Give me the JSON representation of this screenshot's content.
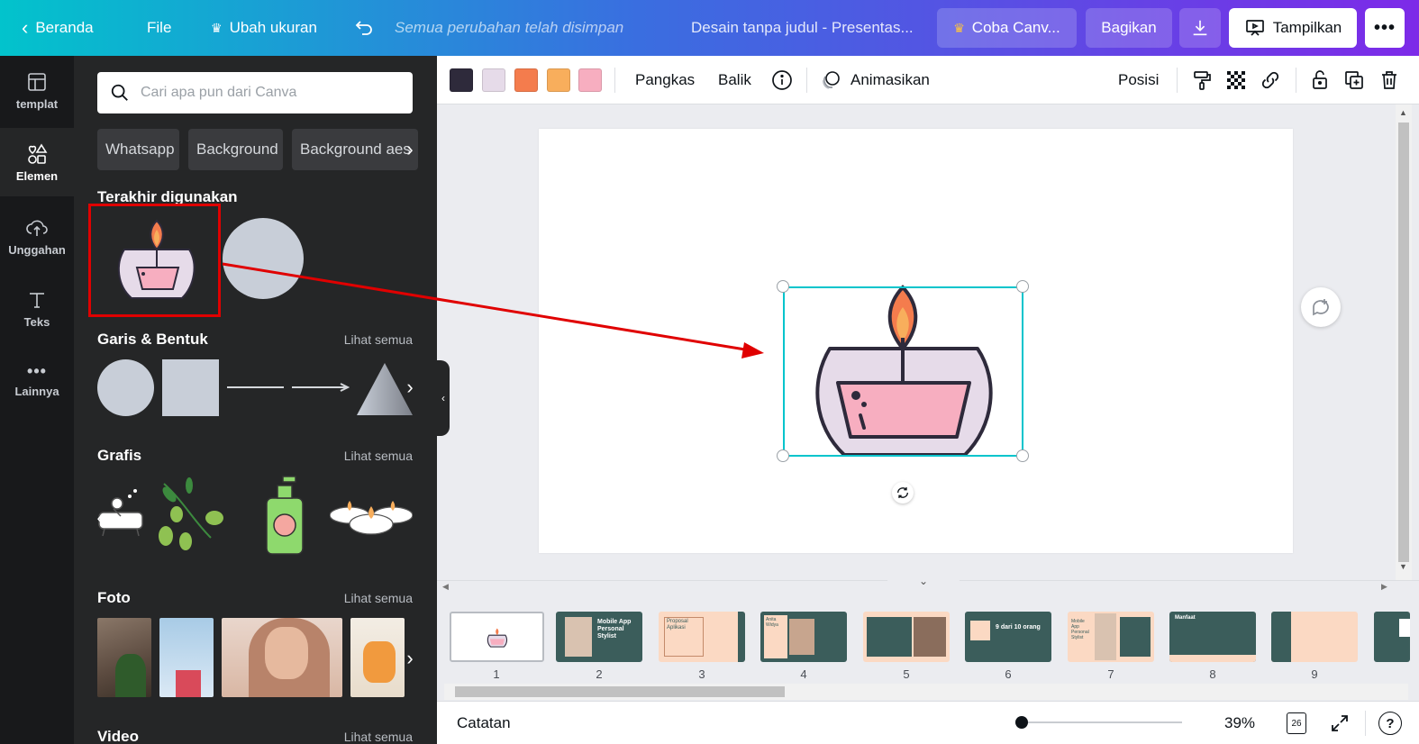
{
  "topbar": {
    "home": "Beranda",
    "file": "File",
    "resize": "Ubah ukuran",
    "saved_status": "Semua perubahan telah disimpan",
    "doc_title": "Desain tanpa judul - Presentas...",
    "try_pro": "Coba Canv...",
    "share": "Bagikan",
    "present": "Tampilkan"
  },
  "rail": [
    {
      "label": "templat",
      "icon": "template-icon"
    },
    {
      "label": "Elemen",
      "icon": "elements-icon"
    },
    {
      "label": "Unggahan",
      "icon": "upload-icon"
    },
    {
      "label": "Teks",
      "icon": "text-icon"
    },
    {
      "label": "Lainnya",
      "icon": "more-icon"
    }
  ],
  "panel": {
    "search_placeholder": "Cari apa pun dari Canva",
    "chips": [
      "Whatsapp",
      "Background",
      "Background aes"
    ],
    "recent_title": "Terakhir digunakan",
    "shapes_title": "Garis & Bentuk",
    "graphics_title": "Grafis",
    "photos_title": "Foto",
    "video_title": "Video",
    "see_all": "Lihat semua"
  },
  "toolbar": {
    "colors": [
      "#2e2a3b",
      "#e6dbe9",
      "#f47c4d",
      "#f8ae5c",
      "#f7aec0"
    ],
    "crop": "Pangkas",
    "flip": "Balik",
    "animate": "Animasikan",
    "position": "Posisi"
  },
  "pages": [
    "1",
    "2",
    "3",
    "4",
    "5",
    "6",
    "7",
    "8",
    "9"
  ],
  "thumb_texts": {
    "t2": "Mobile App Personal Stylist",
    "t3": "Proposal Aplikasi",
    "t4": "Anita Widya",
    "t6": "9 dari 10 orang",
    "t7": "Mobile App Personal Stylist",
    "t8": "Manfaat"
  },
  "footer": {
    "notes": "Catatan",
    "zoom": "39%",
    "page_count": "26"
  }
}
